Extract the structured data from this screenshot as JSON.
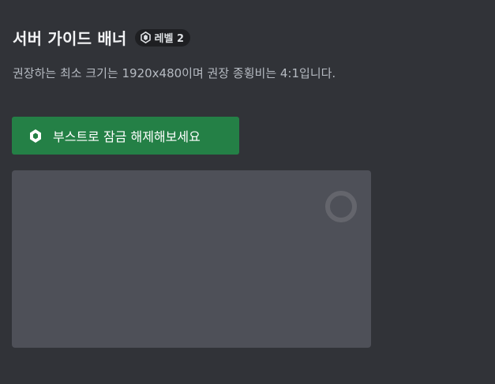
{
  "header": {
    "title": "서버 가이드 배너",
    "level_badge": {
      "icon": "boost-gem-icon",
      "label": "레벨 2"
    }
  },
  "description": "권장하는 최소 크기는 1920x480이며 권장 종횡비는 4:1입니다.",
  "boost_button": {
    "icon": "boost-gem-icon",
    "label": "부스트로 잠금 해제해보세요"
  },
  "upload_area": {
    "icon": "upload-image-icon"
  },
  "colors": {
    "background": "#313338",
    "button": "#248046",
    "upload_area": "#4e5058",
    "badge": "#1e1f22"
  }
}
